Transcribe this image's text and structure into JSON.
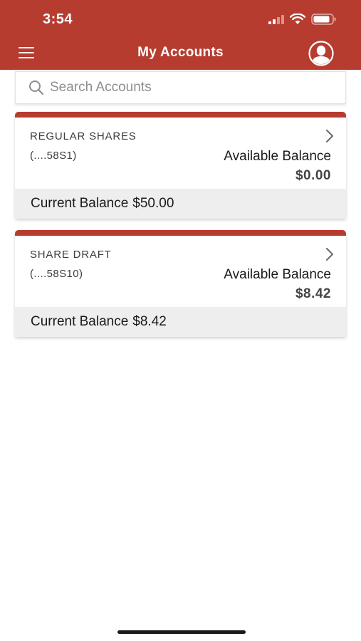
{
  "status_bar": {
    "time": "3:54",
    "icons": [
      "cellular-signal-icon",
      "wifi-icon",
      "battery-icon"
    ]
  },
  "nav": {
    "title": "My Accounts",
    "menu_icon": "hamburger-menu-icon",
    "profile_icon": "user-profile-icon"
  },
  "search": {
    "placeholder": "Search Accounts",
    "value": "",
    "icon": "search-icon"
  },
  "accounts": [
    {
      "name": "REGULAR SHARES",
      "number": "(....58S1)",
      "available_label": "Available Balance",
      "available_value": "$0.00",
      "current_label": "Current Balance",
      "current_value": "$50.00"
    },
    {
      "name": "SHARE DRAFT",
      "number": "(....58S10)",
      "available_label": "Available Balance",
      "available_value": "$8.42",
      "current_label": "Current Balance",
      "current_value": "$8.42"
    }
  ],
  "colors": {
    "brand": "#b63c30",
    "card_footer": "#eeeeee",
    "background": "#ffffff"
  }
}
